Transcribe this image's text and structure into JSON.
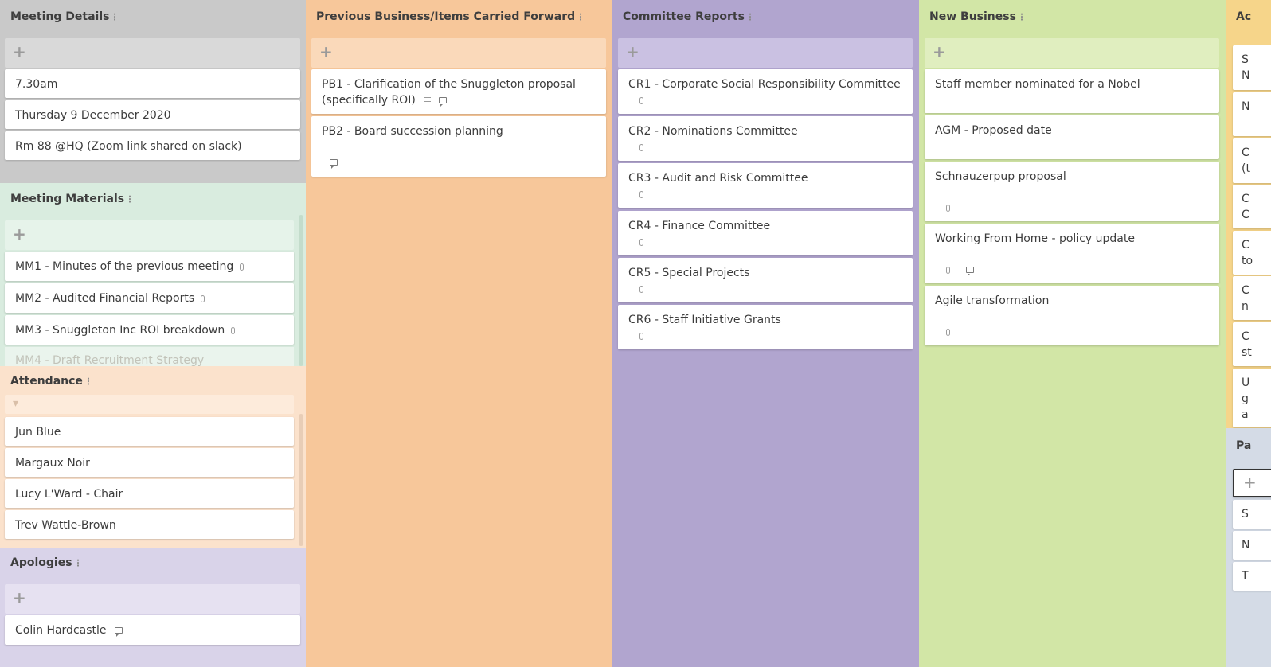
{
  "colors": {
    "meeting_details": "#c9c9c9",
    "meeting_materials": "#d9ecdf",
    "attendance": "#fbe2cc",
    "apologies": "#d9d3e9",
    "previous_business": "#f7c79a",
    "committee_reports": "#b1a5cf",
    "new_business": "#d2e6a6",
    "actions": "#f6d58a"
  },
  "meeting_details": {
    "title": "Meeting Details",
    "add": "+",
    "cards": [
      "7.30am",
      "Thursday 9 December 2020",
      "Rm 88 @HQ (Zoom link shared on slack)"
    ]
  },
  "meeting_materials": {
    "title": "Meeting Materials",
    "add": "+",
    "cards": [
      "MM1 - Minutes of the previous meeting",
      "MM2 - Audited Financial Reports",
      "MM3 - Snuggleton Inc ROI breakdown"
    ],
    "partial": "MM4 - Draft Recruitment Strategy"
  },
  "attendance": {
    "title": "Attendance",
    "add": "+",
    "cards": [
      "Jun Blue",
      "Margaux Noir",
      "Lucy L'Ward - Chair",
      "Trev Wattle-Brown"
    ]
  },
  "apologies": {
    "title": "Apologies",
    "add": "+",
    "cards": [
      "Colin Hardcastle"
    ]
  },
  "previous_business": {
    "title": "Previous Business/Items Carried Forward",
    "add": "+",
    "cards": [
      {
        "line1": "PB1 - Clarification of the Snuggleton proposal",
        "line2": "(specifically ROI)"
      },
      {
        "line1": "PB2 - Board succession planning"
      }
    ]
  },
  "committee_reports": {
    "title": "Committee Reports",
    "add": "+",
    "cards": [
      "CR1 - Corporate Social Responsibility Committee",
      "CR2 - Nominations Committee",
      "CR3 - Audit and Risk Committee",
      "CR4 - Finance Committee",
      "CR5 - Special Projects",
      "CR6 - Staff Initiative Grants"
    ]
  },
  "new_business": {
    "title": "New Business",
    "add": "+",
    "cards": [
      "Staff member nominated for a Nobel",
      "AGM - Proposed date",
      "Schnauzerpup proposal",
      "Working From Home - policy update",
      "Agile transformation"
    ]
  },
  "actions_peek": {
    "title": "Ac",
    "cards": [
      "S\nN",
      "N",
      "C\n(t",
      "C\nC",
      "C\nto",
      "C\nn",
      "C\nst",
      "U\ng\na"
    ]
  },
  "parking_peek": {
    "title": "Pa",
    "add": "+",
    "cards": [
      "S",
      "N",
      "T"
    ]
  }
}
